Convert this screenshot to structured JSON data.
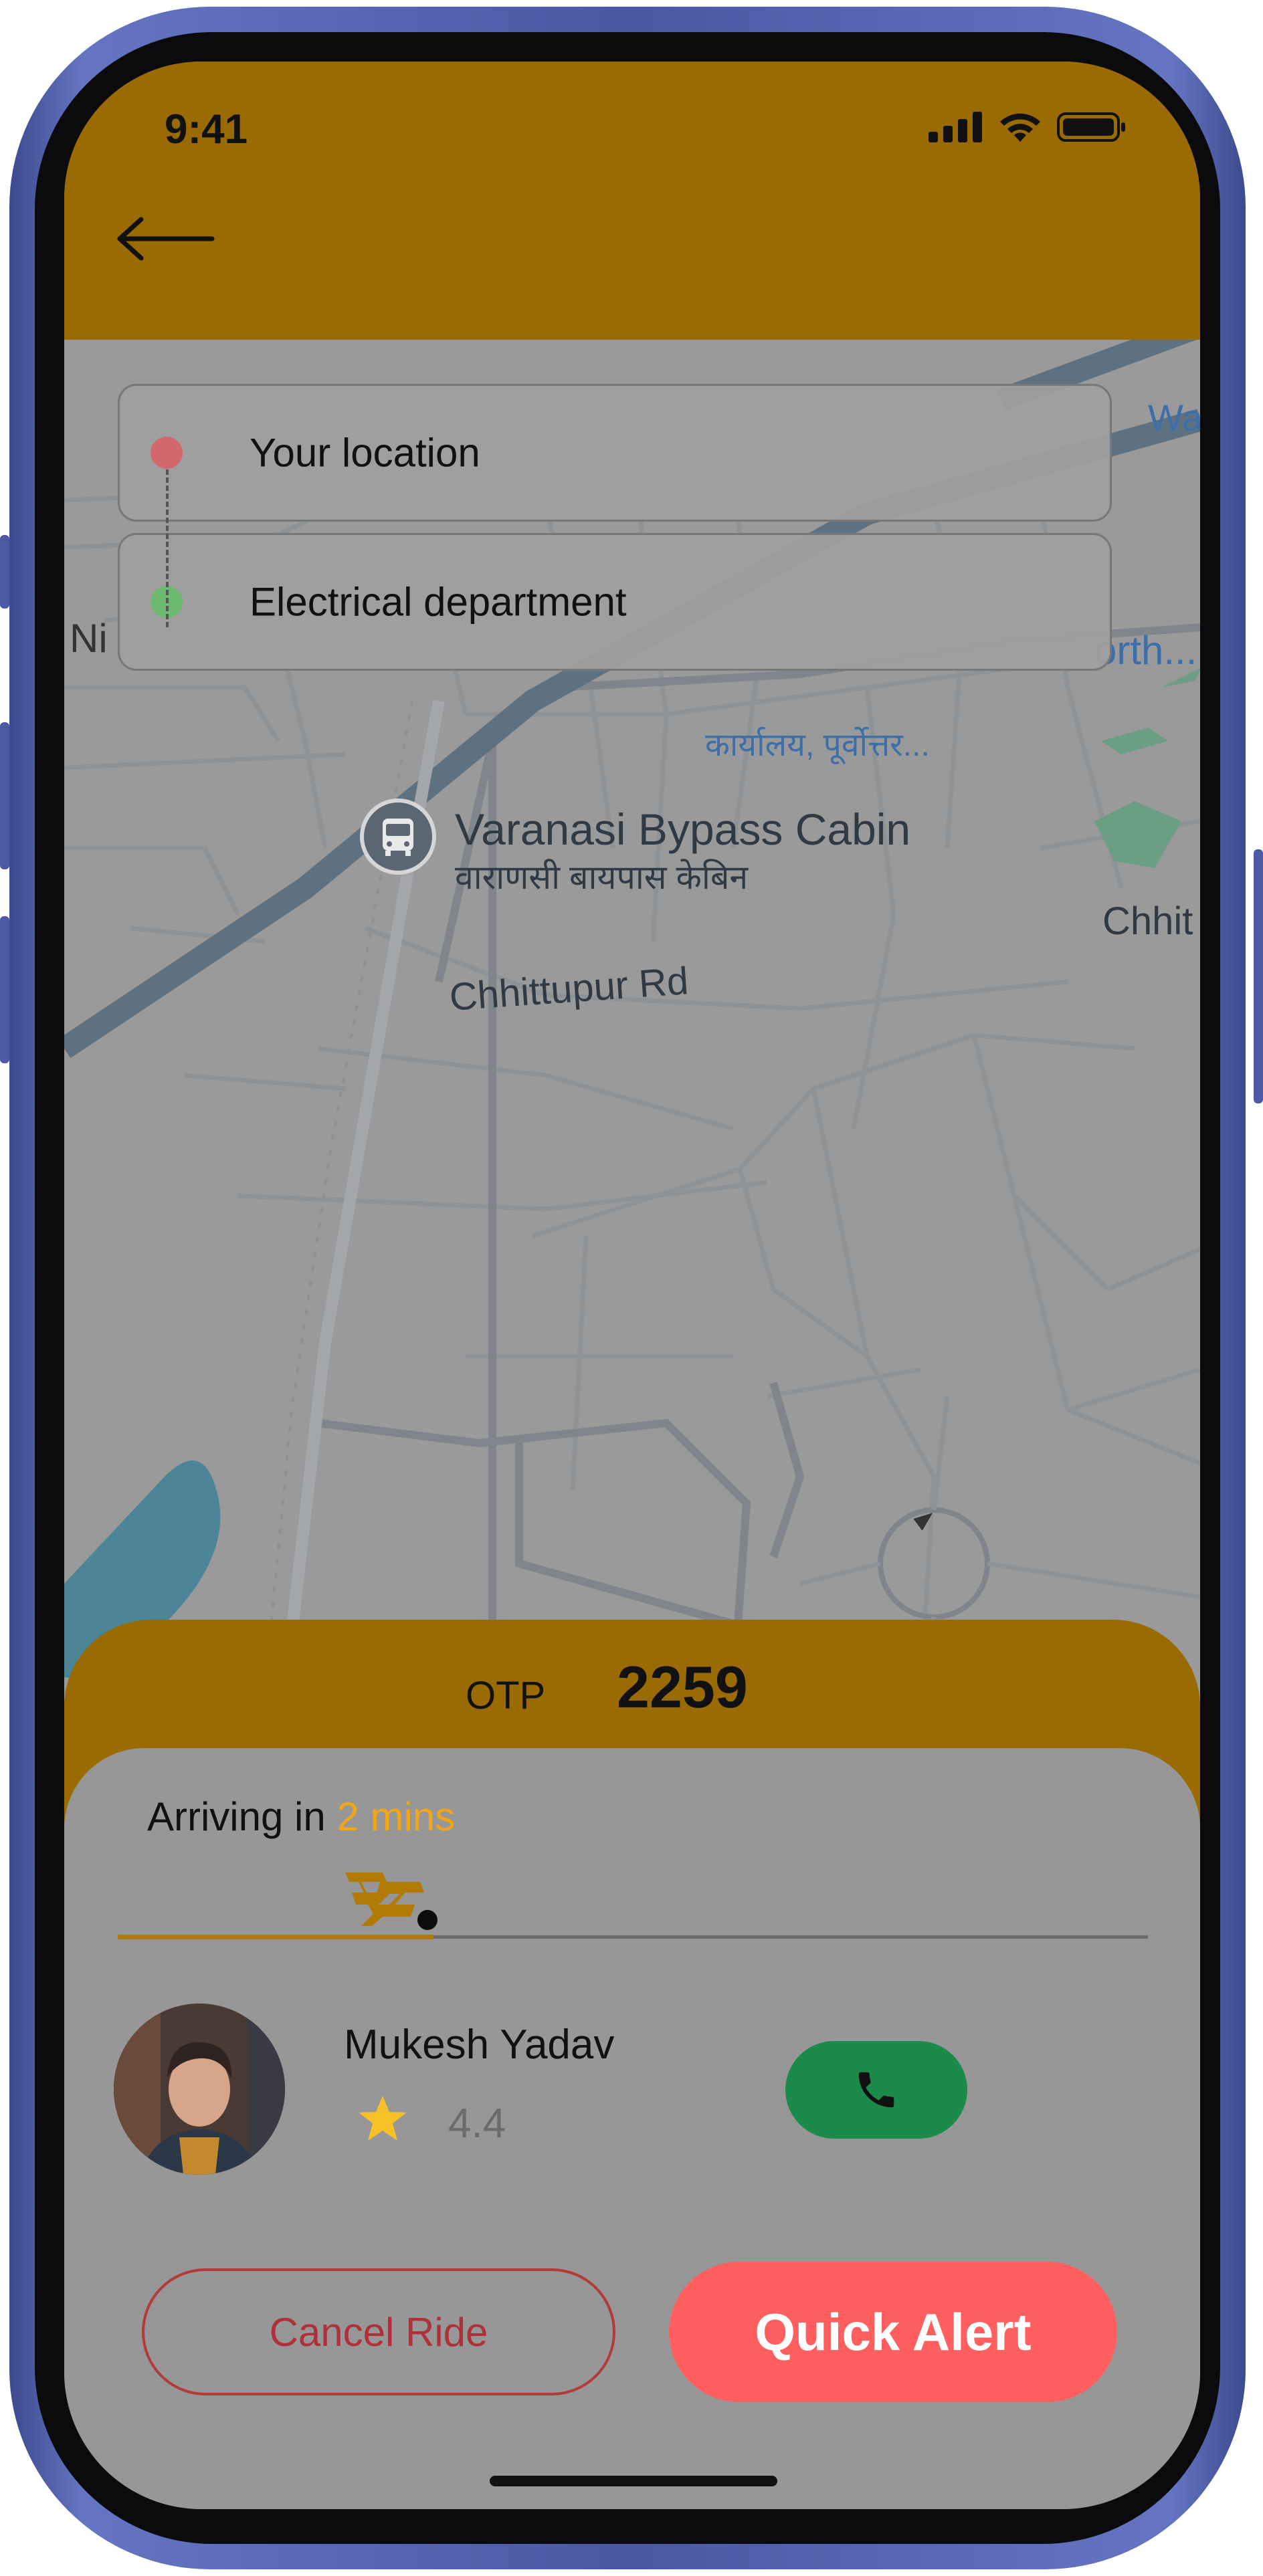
{
  "status_bar": {
    "time": "9:41"
  },
  "header": {
    "back_icon": "arrow-left-icon",
    "color": "#9a6b02"
  },
  "route": {
    "origin": {
      "label": "Your location",
      "dot_color": "#d2686d"
    },
    "destination": {
      "label": "Electrical department",
      "dot_color": "#6bba6f"
    }
  },
  "map": {
    "labels": {
      "bypass_cabin_en": "Varanasi Bypass Cabin",
      "bypass_cabin_hi": "वाराणसी बायपास केबिन",
      "road": "Chhittupur Rd",
      "office_hi": "कार्यालय, पूर्वोत्तर...",
      "north_partial": "orth...",
      "chhit_partial": "Chhit",
      "ni_partial": "Ni",
      "wa_partial": "Wa"
    }
  },
  "otp": {
    "label": "OTP",
    "value": "2259"
  },
  "arrival": {
    "prefix": "Arriving in",
    "eta": "2 mins",
    "progress": 0.3
  },
  "driver": {
    "name": "Mukesh Yadav",
    "rating": "4.4",
    "call_icon": "phone-icon"
  },
  "actions": {
    "cancel_label": "Cancel Ride",
    "alert_label": "Quick Alert"
  },
  "colors": {
    "accent": "#9a6b02",
    "eta": "#f2a516",
    "call": "#1b8a4b",
    "alert": "#ff5f5f",
    "cancel": "#b0303a"
  }
}
